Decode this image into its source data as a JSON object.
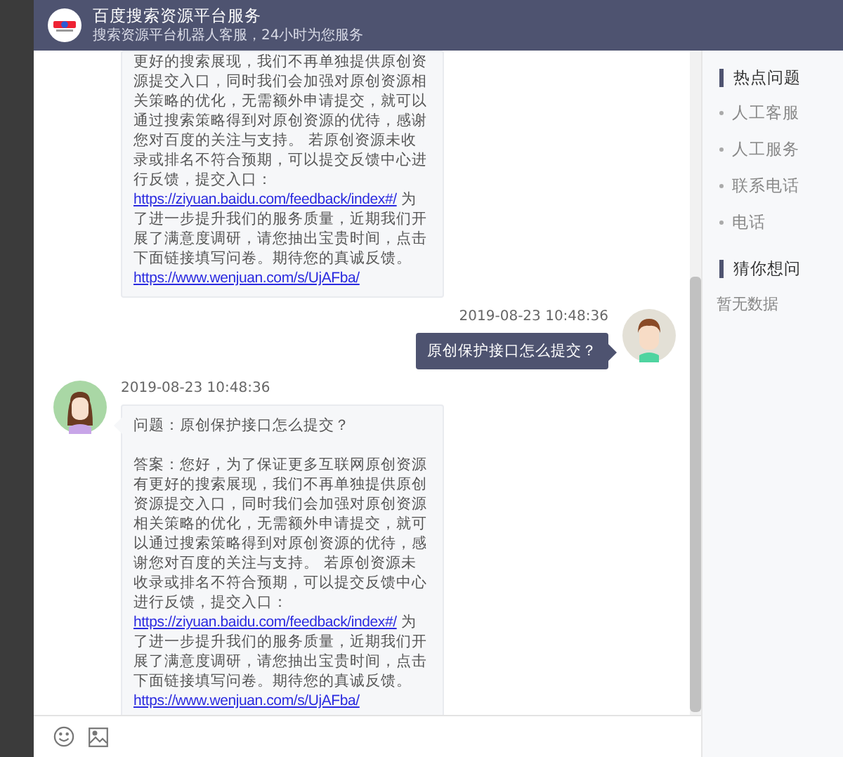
{
  "header": {
    "title": "百度搜索资源平台服务",
    "subtitle": "搜索资源平台机器人客服，24小时为您服务"
  },
  "messages": [
    {
      "kind": "continued",
      "paragraphs": [
        [
          {
            "kind": "text",
            "text": "更好的搜索展现，我们不再单独提供原创资源提交入口，同时我们会加强对原创资源相关策略的优化，无需额外申请提交，就可以通过搜索策略得到对原创资源的优待，感谢您对百度的关注与支持。 若原创资源未收录或排名不符合预期，可以提交反馈中心进行反馈，提交入口："
          },
          {
            "kind": "link",
            "text": "https://ziyuan.baidu.com/feedback/index#/"
          },
          {
            "kind": "text",
            "text": " 为了进一步提升我们的服务质量，近期我们开展了满意度调研，请您抽出宝贵时间，点击下面链接填写问卷。期待您的真诚反馈。"
          },
          {
            "kind": "link",
            "text": "https://www.wenjuan.com/s/UjAFba/"
          }
        ]
      ]
    },
    {
      "kind": "sent",
      "time": "2019-08-23 10:48:36",
      "paragraphs": [
        [
          {
            "kind": "text",
            "text": "原创保护接口怎么提交？"
          }
        ]
      ]
    },
    {
      "kind": "received",
      "time": "2019-08-23 10:48:36",
      "paragraphs": [
        [
          {
            "kind": "text",
            "text": "问题：原创保护接口怎么提交？"
          }
        ],
        [
          {
            "kind": "text",
            "text": "答案：您好，为了保证更多互联网原创资源有更好的搜索展现，我们不再单独提供原创资源提交入口，同时我们会加强对原创资源相关策略的优化，无需额外申请提交，就可以通过搜索策略得到对原创资源的优待，感谢您对百度的关注与支持。 若原创资源未收录或排名不符合预期，可以提交反馈中心进行反馈，提交入口："
          },
          {
            "kind": "link",
            "text": "https://ziyuan.baidu.com/feedback/index#/"
          },
          {
            "kind": "text",
            "text": " 为了进一步提升我们的服务质量，近期我们开展了满意度调研，请您抽出宝贵时间，点击下面链接填写问卷。期待您的真诚反馈。"
          },
          {
            "kind": "link",
            "text": "https://www.wenjuan.com/s/UjAFba/"
          }
        ]
      ]
    }
  ],
  "sidebar": {
    "sections": [
      {
        "title": "热点问题",
        "items": [
          "人工客服",
          "人工服务",
          "联系电话",
          "电话"
        ]
      },
      {
        "title": "猜你想问",
        "empty": "暂无数据"
      }
    ]
  }
}
